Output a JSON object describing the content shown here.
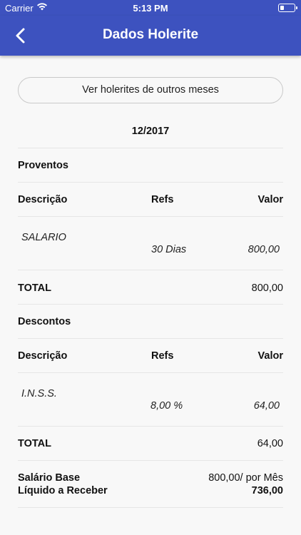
{
  "status_bar": {
    "carrier": "Carrier",
    "time": "5:13 PM"
  },
  "nav": {
    "title": "Dados Holerite"
  },
  "months_button": "Ver holerites de outros meses",
  "period": "12/2017",
  "proventos": {
    "section_title": "Proventos",
    "headers": {
      "descricao": "Descrição",
      "refs": "Refs",
      "valor": "Valor"
    },
    "items": [
      {
        "descricao": "SALARIO",
        "refs": "30 Dias",
        "valor": "800,00"
      }
    ],
    "total_label": "TOTAL",
    "total_value": "800,00"
  },
  "descontos": {
    "section_title": "Descontos",
    "headers": {
      "descricao": "Descrição",
      "refs": "Refs",
      "valor": "Valor"
    },
    "items": [
      {
        "descricao": "I.N.S.S.",
        "refs": "8,00 %",
        "valor": "64,00"
      }
    ],
    "total_label": "TOTAL",
    "total_value": "64,00"
  },
  "summary": {
    "salario_base_label": "Salário Base",
    "salario_base_value": "800,00/ por Mês",
    "liquido_label": "Líquido a Receber",
    "liquido_value": "736,00"
  }
}
